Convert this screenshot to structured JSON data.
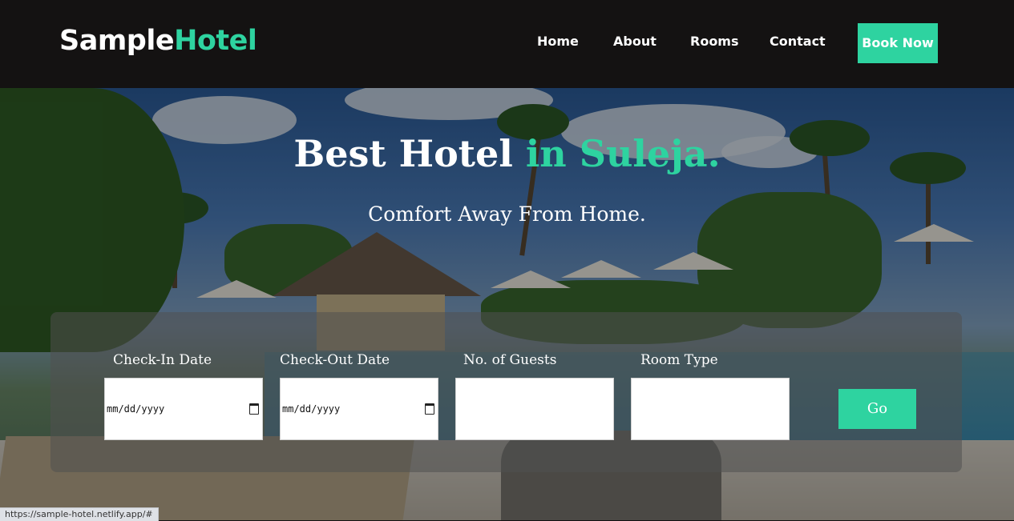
{
  "header": {
    "logo_part1": "Sample",
    "logo_part2": "Hotel",
    "nav": [
      "Home",
      "About",
      "Rooms",
      "Contact"
    ],
    "book_label": "Book Now"
  },
  "hero": {
    "headline_part1": "Best Hotel ",
    "headline_accent": "in Suleja.",
    "subline": "Comfort Away From Home."
  },
  "booking": {
    "checkin_label": "Check-In Date",
    "checkout_label": "Check-Out Date",
    "guests_label": "No. of Guests",
    "roomtype_label": "Room Type",
    "checkin_value": "mm/dd/yyyy",
    "checkout_value": "mm/dd/yyyy",
    "go_label": "Go"
  },
  "status_bar": {
    "url": "https://sample-hotel.netlify.app/#"
  },
  "colors": {
    "accent": "#2ed3a0",
    "header_bg": "#141212"
  }
}
